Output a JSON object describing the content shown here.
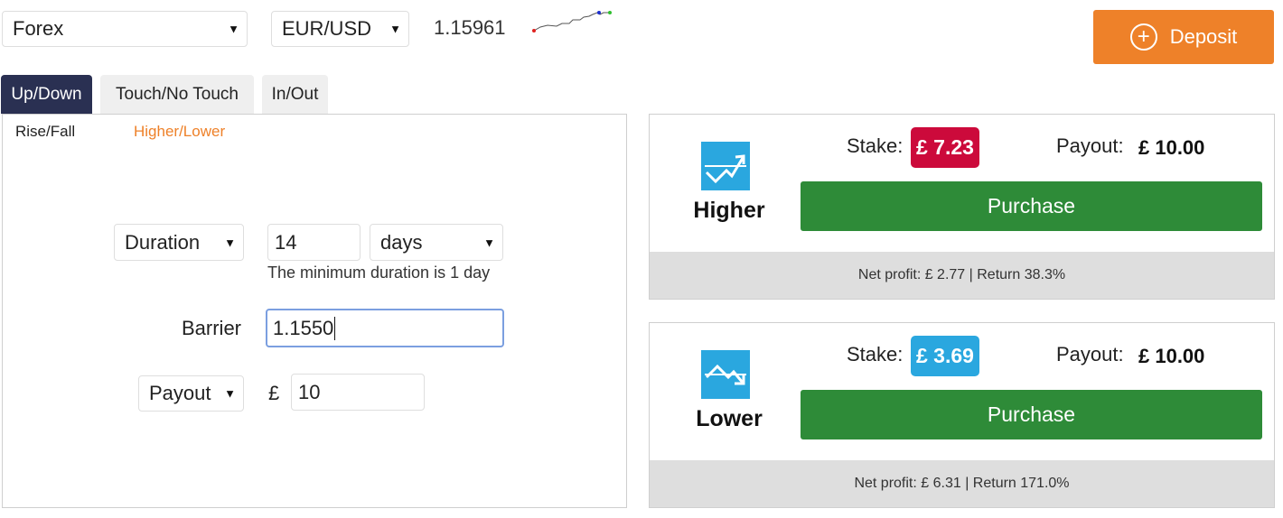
{
  "market_select": {
    "value": "Forex"
  },
  "symbol_select": {
    "value": "EUR/USD"
  },
  "spot_price": "1.15961",
  "deposit": {
    "label": "Deposit"
  },
  "tabs": [
    {
      "label": "Up/Down",
      "active": true
    },
    {
      "label": "Touch/No Touch",
      "active": false
    },
    {
      "label": "In/Out",
      "active": false
    }
  ],
  "subtabs": [
    {
      "label": "Rise/Fall",
      "active": false
    },
    {
      "label": "Higher/Lower",
      "active": true
    }
  ],
  "form": {
    "duration_select": "Duration",
    "duration_amount": "14",
    "duration_unit": "days",
    "duration_hint": "The minimum duration is 1 day",
    "barrier_label": "Barrier",
    "barrier_value": "1.1550",
    "amount_type_select": "Payout",
    "currency_symbol": "£",
    "amount_value": "10"
  },
  "contracts": {
    "higher": {
      "name": "Higher",
      "stake_label": "Stake:",
      "stake_value": "£ 7.23",
      "payout_label": "Payout:",
      "payout_value": "£ 10.00",
      "purchase_label": "Purchase",
      "footer": "Net profit: £ 2.77 | Return 38.3%",
      "stake_color": "#cc0a3b"
    },
    "lower": {
      "name": "Lower",
      "stake_label": "Stake:",
      "stake_value": "£ 3.69",
      "payout_label": "Payout:",
      "payout_value": "£ 10.00",
      "purchase_label": "Purchase",
      "footer": "Net profit: £ 6.31 | Return 171.0%",
      "stake_color": "#2aa7df"
    }
  },
  "colors": {
    "accent": "#ee8129",
    "tab_active": "#2a3052",
    "purchase": "#2e8b38",
    "contract_icon": "#2aa7df"
  }
}
